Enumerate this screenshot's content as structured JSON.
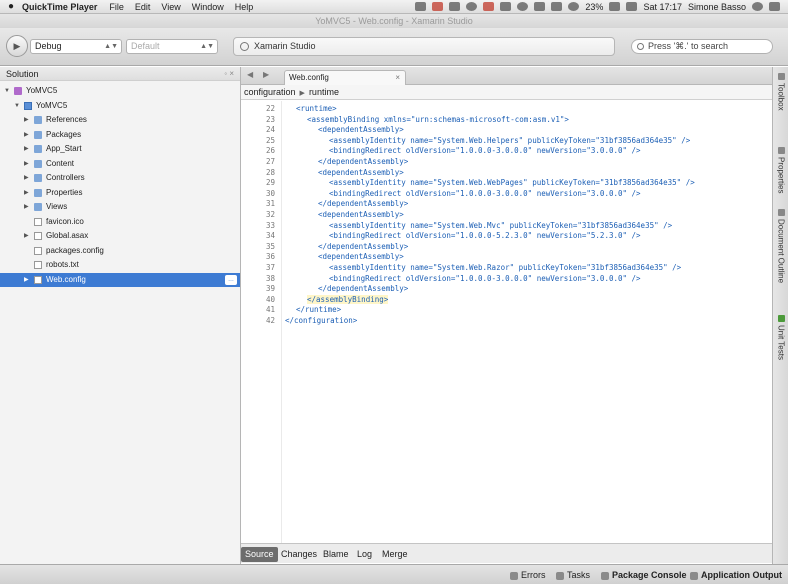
{
  "menubar": {
    "app_name": "QuickTime Player",
    "items": [
      "File",
      "Edit",
      "View",
      "Window",
      "Help"
    ],
    "battery": "23%",
    "clock": "Sat 17:17",
    "user": "Simone Basso"
  },
  "window": {
    "title": "YoMVC5 - Web.config - Xamarin Studio"
  },
  "toolbar": {
    "config": "Debug",
    "target": "Default",
    "status": "Xamarin Studio",
    "search_placeholder": "Press '⌘.' to search"
  },
  "solution": {
    "title": "Solution",
    "controls": "◦ ×",
    "items": [
      {
        "label": "YoMVC5",
        "kind": "sol"
      },
      {
        "label": "YoMVC5",
        "kind": "proj"
      },
      {
        "label": "References",
        "kind": "folder"
      },
      {
        "label": "Packages",
        "kind": "folder"
      },
      {
        "label": "App_Start",
        "kind": "folder"
      },
      {
        "label": "Content",
        "kind": "folder"
      },
      {
        "label": "Controllers",
        "kind": "folder"
      },
      {
        "label": "Properties",
        "kind": "folder"
      },
      {
        "label": "Views",
        "kind": "folder"
      },
      {
        "label": "favicon.ico",
        "kind": "file"
      },
      {
        "label": "Global.asax",
        "kind": "file"
      },
      {
        "label": "packages.config",
        "kind": "file"
      },
      {
        "label": "robots.txt",
        "kind": "file"
      },
      {
        "label": "Web.config",
        "kind": "file"
      }
    ]
  },
  "editor": {
    "tab_label": "Web.config",
    "tab_close": "×",
    "breadcrumb": [
      "configuration",
      "runtime"
    ],
    "current_line": 40,
    "lines": [
      {
        "n": "22",
        "text": "<runtime>",
        "indent": 0
      },
      {
        "n": "23",
        "text": "<assemblyBinding xmlns=\"urn:schemas-microsoft-com:asm.v1\">",
        "indent": 1
      },
      {
        "n": "24",
        "text": "<dependentAssembly>",
        "indent": 2
      },
      {
        "n": "25",
        "text": "<assemblyIdentity name=\"System.Web.Helpers\" publicKeyToken=\"31bf3856ad364e35\" />",
        "indent": 3
      },
      {
        "n": "26",
        "text": "<bindingRedirect oldVersion=\"1.0.0.0-3.0.0.0\" newVersion=\"3.0.0.0\" />",
        "indent": 3
      },
      {
        "n": "27",
        "text": "</dependentAssembly>",
        "indent": 2
      },
      {
        "n": "28",
        "text": "<dependentAssembly>",
        "indent": 2
      },
      {
        "n": "29",
        "text": "<assemblyIdentity name=\"System.Web.WebPages\" publicKeyToken=\"31bf3856ad364e35\" />",
        "indent": 3
      },
      {
        "n": "30",
        "text": "<bindingRedirect oldVersion=\"1.0.0.0-3.0.0.0\" newVersion=\"3.0.0.0\" />",
        "indent": 3
      },
      {
        "n": "31",
        "text": "</dependentAssembly>",
        "indent": 2
      },
      {
        "n": "32",
        "text": "<dependentAssembly>",
        "indent": 2
      },
      {
        "n": "33",
        "text": "<assemblyIdentity name=\"System.Web.Mvc\" publicKeyToken=\"31bf3856ad364e35\" />",
        "indent": 3
      },
      {
        "n": "34",
        "text": "<bindingRedirect oldVersion=\"1.0.0.0-5.2.3.0\" newVersion=\"5.2.3.0\" />",
        "indent": 3
      },
      {
        "n": "35",
        "text": "</dependentAssembly>",
        "indent": 2
      },
      {
        "n": "36",
        "text": "<dependentAssembly>",
        "indent": 2
      },
      {
        "n": "37",
        "text": "<assemblyIdentity name=\"System.Web.Razor\" publicKeyToken=\"31bf3856ad364e35\" />",
        "indent": 3
      },
      {
        "n": "38",
        "text": "<bindingRedirect oldVersion=\"1.0.0.0-3.0.0.0\" newVersion=\"3.0.0.0\" />",
        "indent": 3
      },
      {
        "n": "39",
        "text": "</dependentAssembly>",
        "indent": 2
      },
      {
        "n": "40",
        "text": "</assemblyBinding>",
        "indent": 1
      },
      {
        "n": "41",
        "text": "</runtime>",
        "indent": 0
      },
      {
        "n": "42",
        "text": "</configuration>",
        "indent": -1
      }
    ]
  },
  "bottom_tabs": [
    "Source",
    "Changes",
    "Blame",
    "Log",
    "Merge"
  ],
  "right_dock": [
    "Toolbox",
    "Properties",
    "Document Outline",
    "Unit Tests"
  ],
  "statusbar": {
    "errors": "Errors",
    "tasks": "Tasks",
    "package_console": "Package Console",
    "application_output": "Application Output"
  }
}
